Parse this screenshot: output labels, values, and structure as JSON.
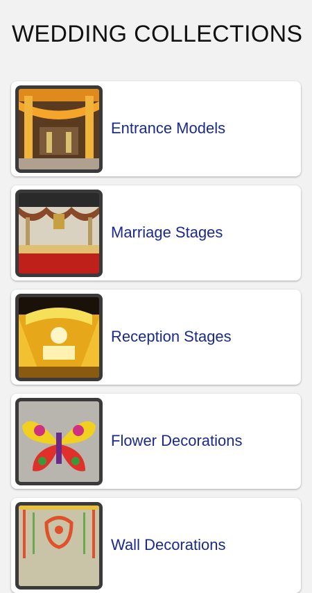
{
  "page": {
    "title": "WEDDING COLLECTIONS"
  },
  "collections": [
    {
      "label": "Entrance Models",
      "image": "entrance-models-thumbnail"
    },
    {
      "label": "Marriage Stages",
      "image": "marriage-stages-thumbnail"
    },
    {
      "label": "Reception Stages",
      "image": "reception-stages-thumbnail"
    },
    {
      "label": "Flower Decorations",
      "image": "flower-decorations-thumbnail"
    },
    {
      "label": "Wall Decorations",
      "image": "wall-decorations-thumbnail"
    }
  ],
  "colors": {
    "background": "#f2f2f2",
    "card": "#ffffff",
    "label_text": "#1a2a8c",
    "title_text": "#111111",
    "thumb_frame": "#3a3a3a"
  }
}
